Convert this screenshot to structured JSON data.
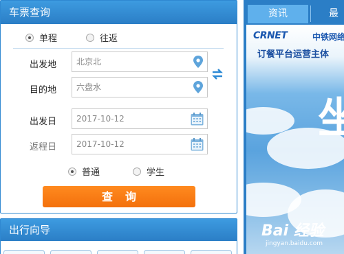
{
  "query": {
    "title": "车票查询",
    "trip_types": [
      {
        "label": "单程",
        "checked": true
      },
      {
        "label": "往返",
        "checked": false
      }
    ],
    "from_label": "出发地",
    "from_value": "北京北",
    "to_label": "目的地",
    "to_value": "六盘水",
    "depart_label": "出发日",
    "depart_value": "2017-10-12",
    "return_label": "返程日",
    "return_value": "2017-10-12",
    "passenger_types": [
      {
        "label": "普通",
        "checked": true
      },
      {
        "label": "学生",
        "checked": false
      }
    ],
    "submit_label": "查询"
  },
  "guide": {
    "title": "出行向导"
  },
  "info": {
    "tabs": [
      {
        "label": "资讯",
        "active": true
      },
      {
        "label": "最新",
        "active": false
      }
    ],
    "ad_logo_en": "CRNET",
    "ad_logo_cn": "中铁网络",
    "ad_tagline": "订餐平台运营主体",
    "ad_big_char": "坐",
    "watermark": "Bai 经验",
    "watermark_sub": "jingyan.baidu.com"
  },
  "colors": {
    "panel_blue": "#2b7ec6",
    "accent_orange": "#f3700c",
    "tab_active": "#5fb0ec"
  },
  "icons": [
    "location-pin-icon",
    "swap-icon",
    "calendar-icon"
  ]
}
